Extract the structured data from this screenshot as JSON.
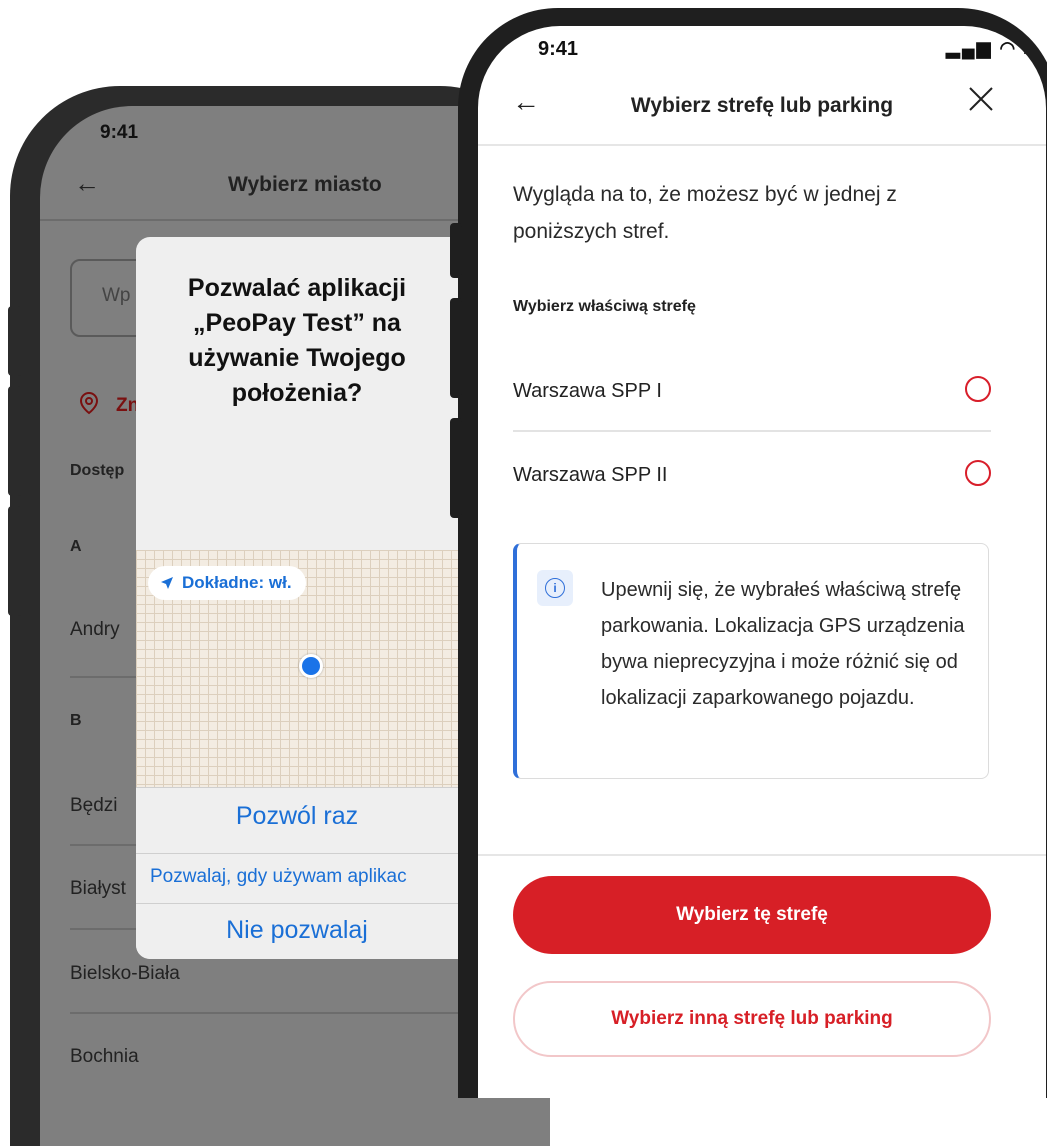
{
  "back_screen": {
    "time": "9:41",
    "title": "Wybierz miasto",
    "search_placeholder": "Wp",
    "locate_text": "Zn",
    "section_label": "Dostęp",
    "letters": [
      "A",
      "B"
    ],
    "cities": [
      "Andry",
      "Będzi",
      "Białyst",
      "Bielsko-Biała",
      "Bochnia"
    ]
  },
  "alert": {
    "title_lines": [
      "Pozwalać aplikacji",
      "„PeoPay Test” na",
      "używanie Twojego",
      "położenia?"
    ],
    "precise_chip": "Dokładne: wł.",
    "allow_once": "Pozwól raz",
    "allow_while_using": "Pozwalaj, gdy używam aplikac",
    "dont_allow": "Nie pozwalaj"
  },
  "front_screen": {
    "time": "9:41",
    "status_icons": "▂▄▆ ◠ ▬",
    "title": "Wybierz strefę lub parking",
    "intro": "Wygląda na to, że możesz być w jednej z poniższych stref.",
    "choose_label": "Wybierz właściwą strefę",
    "zones": [
      "Warszawa SPP I",
      "Warszawa SPP II"
    ],
    "info_icon": "i",
    "info_text": "Upewnij się, że wybrałeś właściwą strefę parkowania. Lokalizacja GPS urządzenia bywa nieprecyzyjna i może różnić się od lokalizacji zaparkowanego pojazdu.",
    "primary_button": "Wybierz tę strefę",
    "secondary_button": "Wybierz inną strefę lub parking"
  },
  "colors": {
    "brand_red": "#d71f26",
    "info_blue": "#2f6fd9",
    "ios_blue": "#1a6fd6"
  }
}
